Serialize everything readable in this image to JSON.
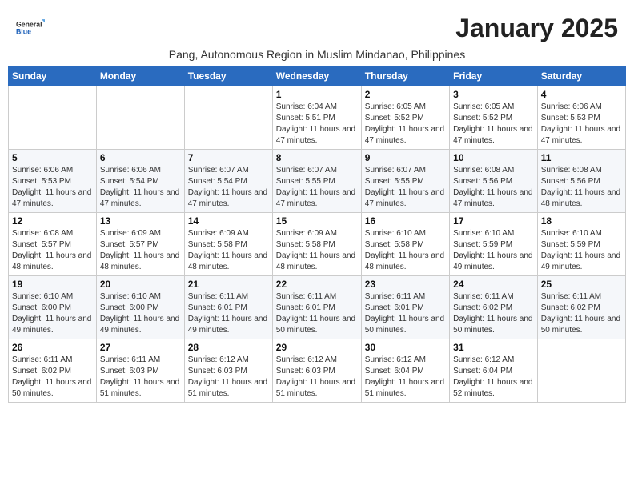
{
  "header": {
    "logo_general": "General",
    "logo_blue": "Blue",
    "month_title": "January 2025",
    "subtitle": "Pang, Autonomous Region in Muslim Mindanao, Philippines"
  },
  "days_of_week": [
    "Sunday",
    "Monday",
    "Tuesday",
    "Wednesday",
    "Thursday",
    "Friday",
    "Saturday"
  ],
  "weeks": [
    [
      {
        "day": "",
        "info": ""
      },
      {
        "day": "",
        "info": ""
      },
      {
        "day": "",
        "info": ""
      },
      {
        "day": "1",
        "info": "Sunrise: 6:04 AM\nSunset: 5:51 PM\nDaylight: 11 hours and 47 minutes."
      },
      {
        "day": "2",
        "info": "Sunrise: 6:05 AM\nSunset: 5:52 PM\nDaylight: 11 hours and 47 minutes."
      },
      {
        "day": "3",
        "info": "Sunrise: 6:05 AM\nSunset: 5:52 PM\nDaylight: 11 hours and 47 minutes."
      },
      {
        "day": "4",
        "info": "Sunrise: 6:06 AM\nSunset: 5:53 PM\nDaylight: 11 hours and 47 minutes."
      }
    ],
    [
      {
        "day": "5",
        "info": "Sunrise: 6:06 AM\nSunset: 5:53 PM\nDaylight: 11 hours and 47 minutes."
      },
      {
        "day": "6",
        "info": "Sunrise: 6:06 AM\nSunset: 5:54 PM\nDaylight: 11 hours and 47 minutes."
      },
      {
        "day": "7",
        "info": "Sunrise: 6:07 AM\nSunset: 5:54 PM\nDaylight: 11 hours and 47 minutes."
      },
      {
        "day": "8",
        "info": "Sunrise: 6:07 AM\nSunset: 5:55 PM\nDaylight: 11 hours and 47 minutes."
      },
      {
        "day": "9",
        "info": "Sunrise: 6:07 AM\nSunset: 5:55 PM\nDaylight: 11 hours and 47 minutes."
      },
      {
        "day": "10",
        "info": "Sunrise: 6:08 AM\nSunset: 5:56 PM\nDaylight: 11 hours and 47 minutes."
      },
      {
        "day": "11",
        "info": "Sunrise: 6:08 AM\nSunset: 5:56 PM\nDaylight: 11 hours and 48 minutes."
      }
    ],
    [
      {
        "day": "12",
        "info": "Sunrise: 6:08 AM\nSunset: 5:57 PM\nDaylight: 11 hours and 48 minutes."
      },
      {
        "day": "13",
        "info": "Sunrise: 6:09 AM\nSunset: 5:57 PM\nDaylight: 11 hours and 48 minutes."
      },
      {
        "day": "14",
        "info": "Sunrise: 6:09 AM\nSunset: 5:58 PM\nDaylight: 11 hours and 48 minutes."
      },
      {
        "day": "15",
        "info": "Sunrise: 6:09 AM\nSunset: 5:58 PM\nDaylight: 11 hours and 48 minutes."
      },
      {
        "day": "16",
        "info": "Sunrise: 6:10 AM\nSunset: 5:58 PM\nDaylight: 11 hours and 48 minutes."
      },
      {
        "day": "17",
        "info": "Sunrise: 6:10 AM\nSunset: 5:59 PM\nDaylight: 11 hours and 49 minutes."
      },
      {
        "day": "18",
        "info": "Sunrise: 6:10 AM\nSunset: 5:59 PM\nDaylight: 11 hours and 49 minutes."
      }
    ],
    [
      {
        "day": "19",
        "info": "Sunrise: 6:10 AM\nSunset: 6:00 PM\nDaylight: 11 hours and 49 minutes."
      },
      {
        "day": "20",
        "info": "Sunrise: 6:10 AM\nSunset: 6:00 PM\nDaylight: 11 hours and 49 minutes."
      },
      {
        "day": "21",
        "info": "Sunrise: 6:11 AM\nSunset: 6:01 PM\nDaylight: 11 hours and 49 minutes."
      },
      {
        "day": "22",
        "info": "Sunrise: 6:11 AM\nSunset: 6:01 PM\nDaylight: 11 hours and 50 minutes."
      },
      {
        "day": "23",
        "info": "Sunrise: 6:11 AM\nSunset: 6:01 PM\nDaylight: 11 hours and 50 minutes."
      },
      {
        "day": "24",
        "info": "Sunrise: 6:11 AM\nSunset: 6:02 PM\nDaylight: 11 hours and 50 minutes."
      },
      {
        "day": "25",
        "info": "Sunrise: 6:11 AM\nSunset: 6:02 PM\nDaylight: 11 hours and 50 minutes."
      }
    ],
    [
      {
        "day": "26",
        "info": "Sunrise: 6:11 AM\nSunset: 6:02 PM\nDaylight: 11 hours and 50 minutes."
      },
      {
        "day": "27",
        "info": "Sunrise: 6:11 AM\nSunset: 6:03 PM\nDaylight: 11 hours and 51 minutes."
      },
      {
        "day": "28",
        "info": "Sunrise: 6:12 AM\nSunset: 6:03 PM\nDaylight: 11 hours and 51 minutes."
      },
      {
        "day": "29",
        "info": "Sunrise: 6:12 AM\nSunset: 6:03 PM\nDaylight: 11 hours and 51 minutes."
      },
      {
        "day": "30",
        "info": "Sunrise: 6:12 AM\nSunset: 6:04 PM\nDaylight: 11 hours and 51 minutes."
      },
      {
        "day": "31",
        "info": "Sunrise: 6:12 AM\nSunset: 6:04 PM\nDaylight: 11 hours and 52 minutes."
      },
      {
        "day": "",
        "info": ""
      }
    ]
  ]
}
